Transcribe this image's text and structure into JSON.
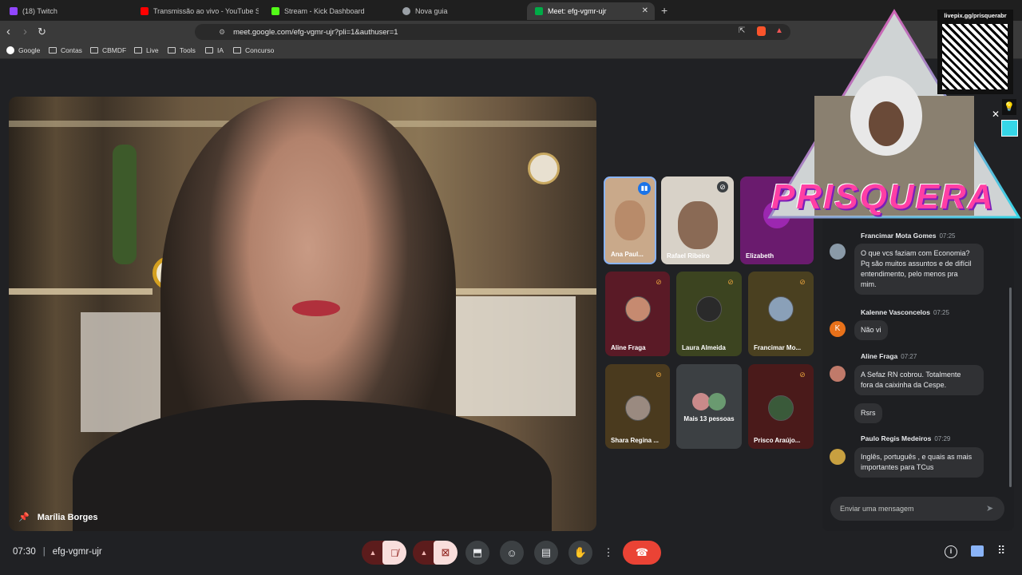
{
  "browser": {
    "tabs": [
      {
        "label": "(18) Twitch",
        "color": "#9146ff"
      },
      {
        "label": "Transmissão ao vivo - YouTube Studio",
        "color": "#ff0000"
      },
      {
        "label": "Stream - Kick Dashboard",
        "color": "#53fc18"
      },
      {
        "label": "Nova guia",
        "color": "#9aa0a6"
      },
      {
        "label": "Meet: efg-vgmr-ujr",
        "color": "#00ac47",
        "active": true
      }
    ],
    "new_tab": "+",
    "url": "meet.google.com/efg-vgmr-ujr?pli=1&authuser=1",
    "bookmarks": [
      "Google",
      "Contas",
      "CBMDF",
      "Live",
      "Tools",
      "IA",
      "Concurso"
    ]
  },
  "meeting": {
    "time": "07:30",
    "code": "efg-vgmr-ujr",
    "main_speaker": "Marília Borges"
  },
  "participants": [
    {
      "name": "Ana Paul...",
      "bg": "#c9a98a"
    },
    {
      "name": "Rafael Ribeiro",
      "bg": "#d8d2c8"
    },
    {
      "name": "Elizabeth",
      "bg": "#6a1b6e"
    },
    {
      "name": "Aline Fraga",
      "bg": "#5a1a26"
    },
    {
      "name": "Laura Almeida",
      "bg": "#3c4420"
    },
    {
      "name": "Francimar Mo...",
      "bg": "#4a4020"
    },
    {
      "name": "Shara Regina ...",
      "bg": "#4a3a1e"
    },
    {
      "name": "Mais 13 pessoas",
      "bg": "#3c4043"
    },
    {
      "name": "Prisco Araújo...",
      "bg": "#4a1a1a"
    }
  ],
  "chat": {
    "messages": [
      {
        "author": "Francimar Mota Gomes",
        "time": "07:25",
        "lines": [
          "O que vcs faziam com Economia?",
          "Pq são muitos assuntos e de difícil",
          "entendimento, pelo menos pra",
          "mim."
        ]
      },
      {
        "author": "Kalenne Vasconcelos",
        "time": "07:25",
        "initial": "K",
        "lines": [
          "Não vi"
        ]
      },
      {
        "author": "Aline Fraga",
        "time": "07:27",
        "lines": [
          "A Sefaz RN cobrou. Totalmente",
          "fora da caixinha da Cespe."
        ]
      },
      {
        "extra": "Rsrs"
      },
      {
        "author": "Paulo Regis Medeiros",
        "time": "07:29",
        "lines": [
          "Inglês, português , e quais as mais",
          "importantes para TCus"
        ]
      }
    ],
    "input_placeholder": "Enviar uma mensagem"
  },
  "overlay": {
    "brand": "PRISQUERA",
    "pix": "livepix.gg/prisquerabr"
  },
  "colors": {
    "hangup": "#ea4335",
    "overlay_pink": "#ff3fa4",
    "overlay_cyan": "#36d6e7"
  }
}
